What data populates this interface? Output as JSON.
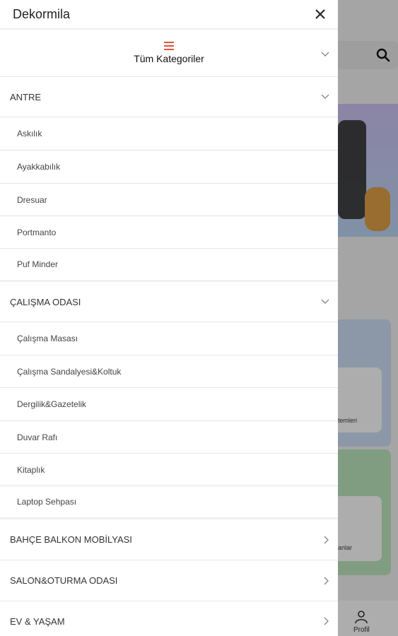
{
  "drawer": {
    "title": "Dekormila",
    "all_categories_label": "Tüm Kategoriler",
    "accent_color": "#e8523a"
  },
  "categories": [
    {
      "label": "ANTRE",
      "expanded": true,
      "items": [
        "Askılık",
        "Ayakkabılık",
        "Dresuar",
        "Portmanto",
        "Puf Minder"
      ]
    },
    {
      "label": "ÇALIŞMA ODASI",
      "expanded": true,
      "items": [
        "Çalışma Masası",
        "Çalışma Sandalyesi&Koltuk",
        "Dergilik&Gazetelik",
        "Duvar Rafı",
        "Kitaplık",
        "Laptop Sehpası"
      ]
    },
    {
      "label": "BAHÇE BALKON MOBİLYASI",
      "expanded": false
    },
    {
      "label": "SALON&OTURMA ODASI",
      "expanded": false
    },
    {
      "label": "EV & YAŞAM",
      "expanded": false
    }
  ],
  "background": {
    "card1_text": "temleri",
    "card2_text": "anlar",
    "profile_label": "Profil"
  }
}
